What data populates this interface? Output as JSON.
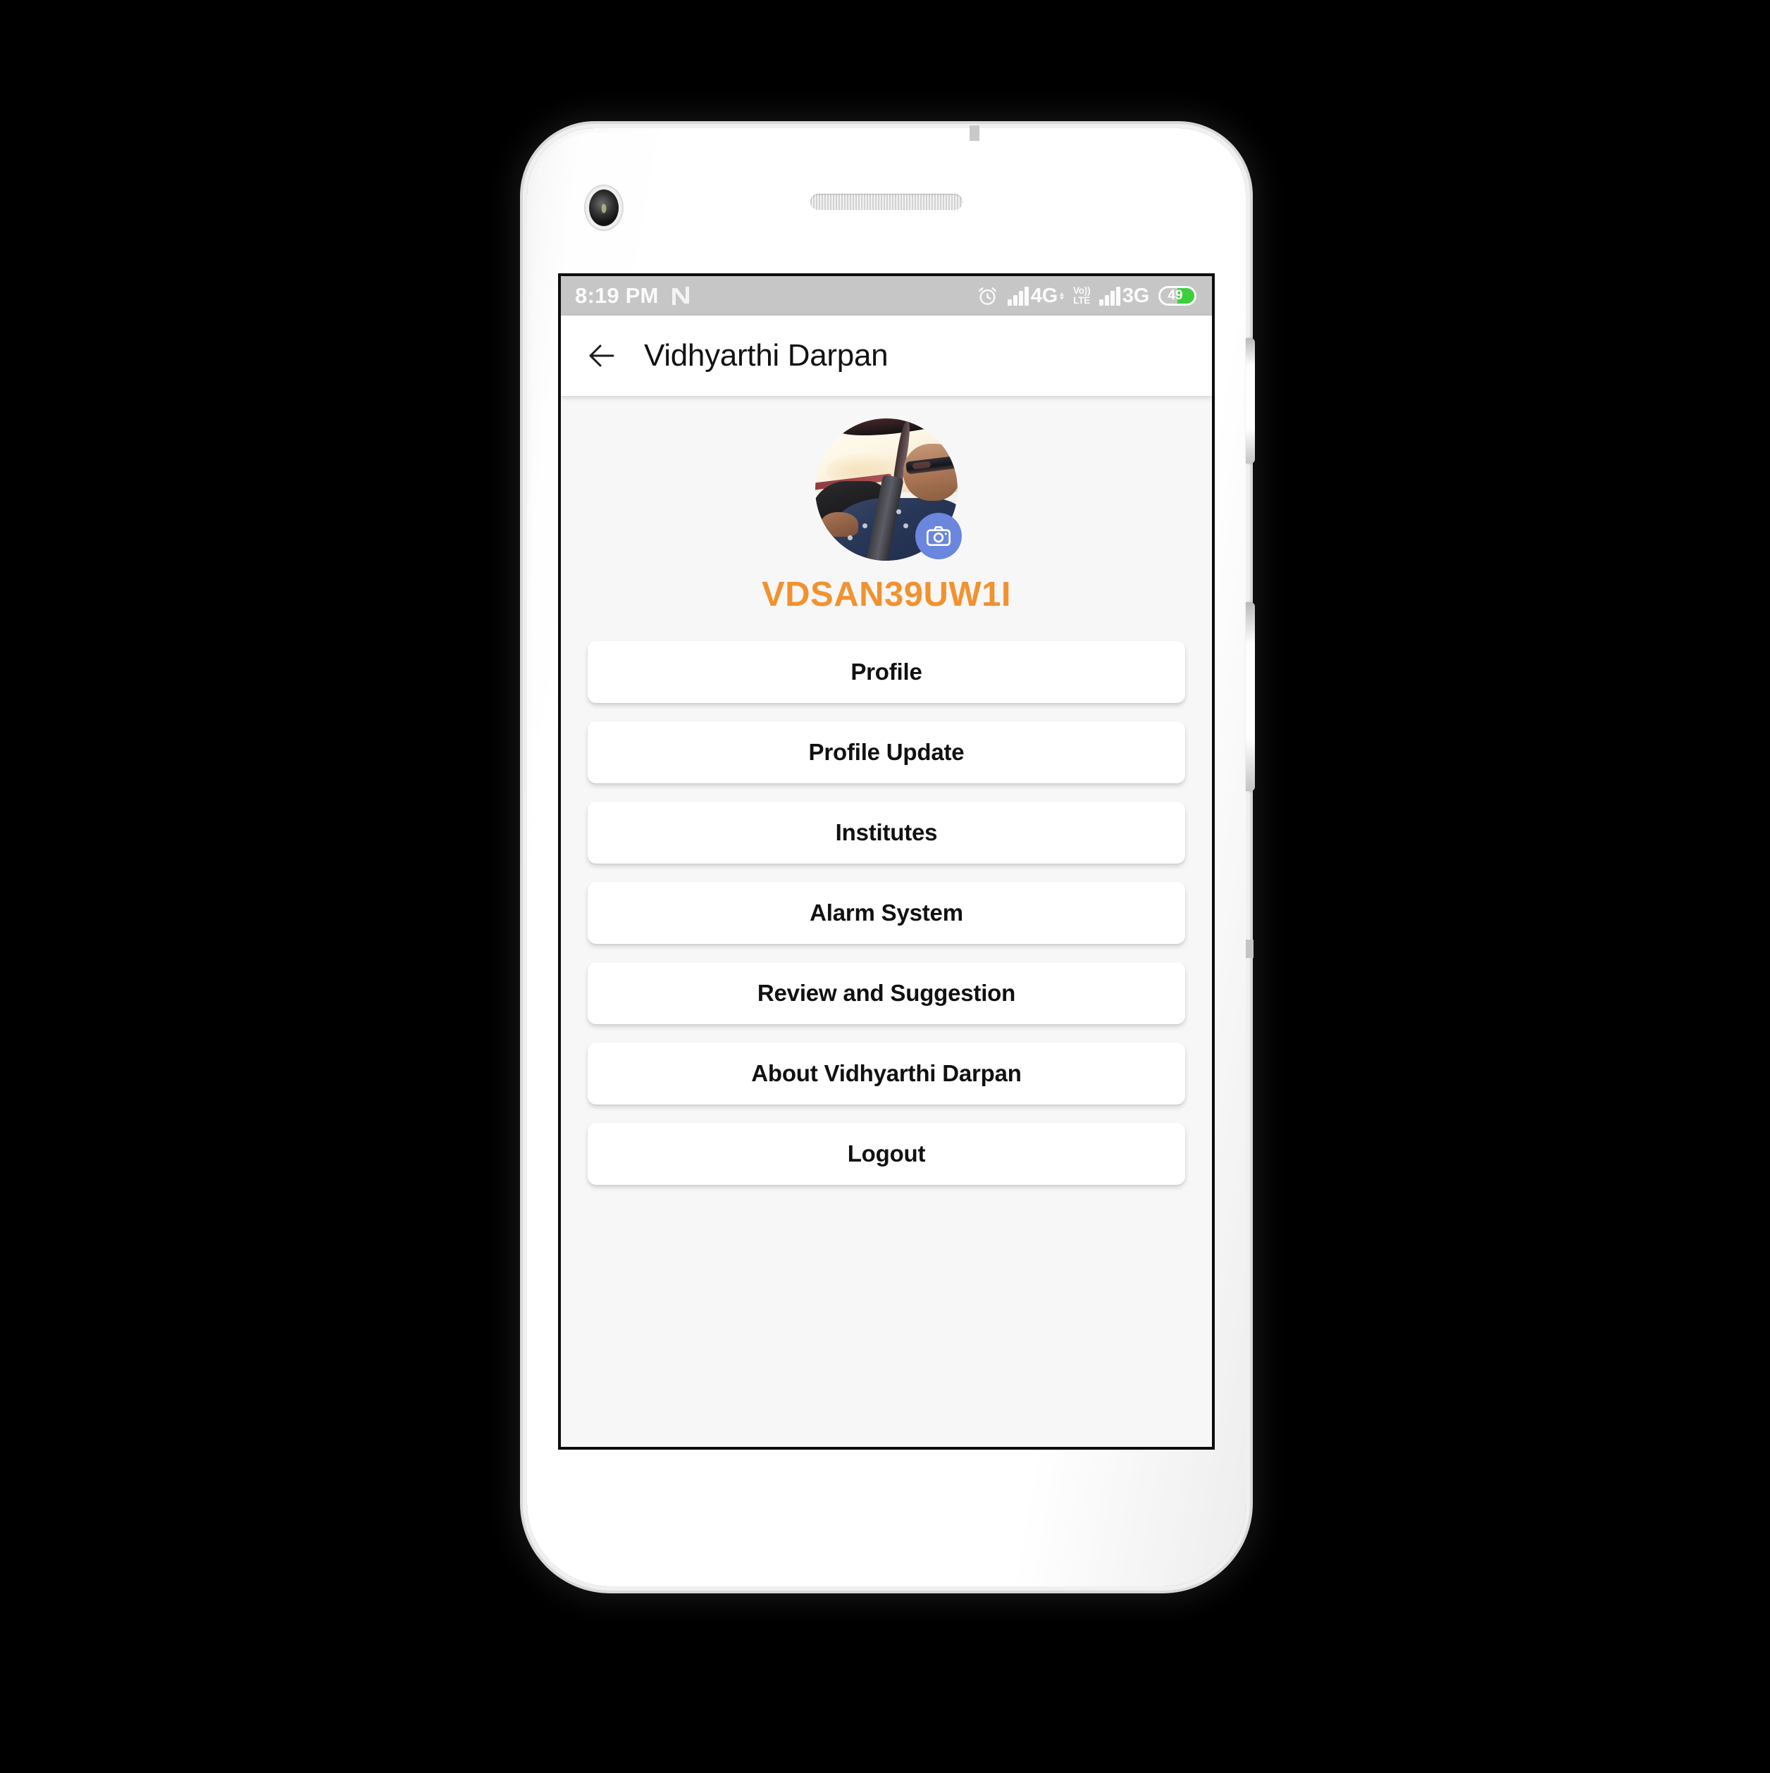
{
  "status_bar": {
    "time": "8:19 PM",
    "os_icon": "android-nougat-icon",
    "alarm_icon": "alarm-clock-icon",
    "signal_1_icon": "signal-bars-icon",
    "network_1": "4G",
    "volte_top": "Vo))",
    "volte_bottom": "LTE",
    "signal_2_icon": "signal-bars-icon",
    "network_2": "3G",
    "battery_percent": "49",
    "battery_level": 49,
    "background_color": "#c6c6c6",
    "text_color": "#fbfbfb",
    "battery_fill_color": "#3ecf3e"
  },
  "app_bar": {
    "back_icon": "back-arrow-icon",
    "title": "Vidhyarthi Darpan",
    "background_color": "#ffffff",
    "title_color": "#121212"
  },
  "profile": {
    "avatar_alt": "user photo of man wearing sunglasses seated in car with seatbelt",
    "camera_icon": "camera-icon",
    "camera_button_color": "#6b86dd",
    "username": "VDSAN39UW1I",
    "username_color": "#f2922f"
  },
  "menu": {
    "items": [
      {
        "label": "Profile"
      },
      {
        "label": "Profile Update"
      },
      {
        "label": "Institutes"
      },
      {
        "label": "Alarm System"
      },
      {
        "label": "Review and Suggestion"
      },
      {
        "label": "About Vidhyarthi Darpan"
      },
      {
        "label": "Logout"
      }
    ],
    "card_color": "#ffffff",
    "label_color": "#111111"
  },
  "screen": {
    "background_color": "#f7f7f8"
  },
  "device": {
    "body_color": "#ffffff",
    "front_camera_icon": "front-camera-icon",
    "earpiece_icon": "earpiece-speaker-icon",
    "sensor_icon": "sensor-pill-icon",
    "power_button": "power-button",
    "volume_button": "volume-button"
  }
}
